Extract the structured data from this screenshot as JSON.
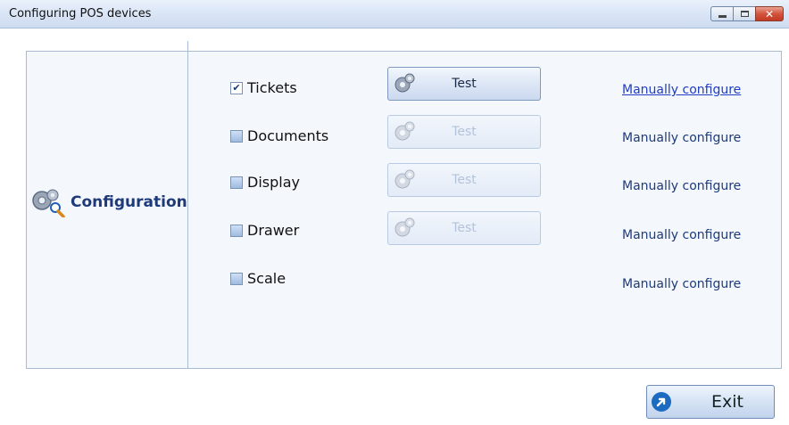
{
  "window": {
    "title": "Configuring POS devices",
    "minimize_icon": "minimize-icon",
    "maximize_icon": "maximize-icon",
    "close_icon": "close-icon"
  },
  "section": {
    "title": "Configuration",
    "icon": "config-gears-icon"
  },
  "devices": [
    {
      "label": "Tickets",
      "checked": true,
      "test_label": "Test",
      "test_enabled": true,
      "configure_label": "Manually configure",
      "configure_is_link": true
    },
    {
      "label": "Documents",
      "checked": false,
      "test_label": "Test",
      "test_enabled": false,
      "configure_label": "Manually configure",
      "configure_is_link": false
    },
    {
      "label": "Display",
      "checked": false,
      "test_label": "Test",
      "test_enabled": false,
      "configure_label": "Manually configure",
      "configure_is_link": false
    },
    {
      "label": "Drawer",
      "checked": false,
      "test_label": "Test",
      "test_enabled": false,
      "configure_label": "Manually configure",
      "configure_is_link": false
    },
    {
      "label": "Scale",
      "checked": false,
      "configure_label": "Manually configure",
      "configure_is_link": false
    }
  ],
  "footer": {
    "exit_label": "Exit",
    "exit_icon": "arrow-circle-icon"
  },
  "colors": {
    "title_text": "#1e3a7a",
    "link": "#1f3cc4",
    "panel_bg": "#f4f8fd"
  }
}
